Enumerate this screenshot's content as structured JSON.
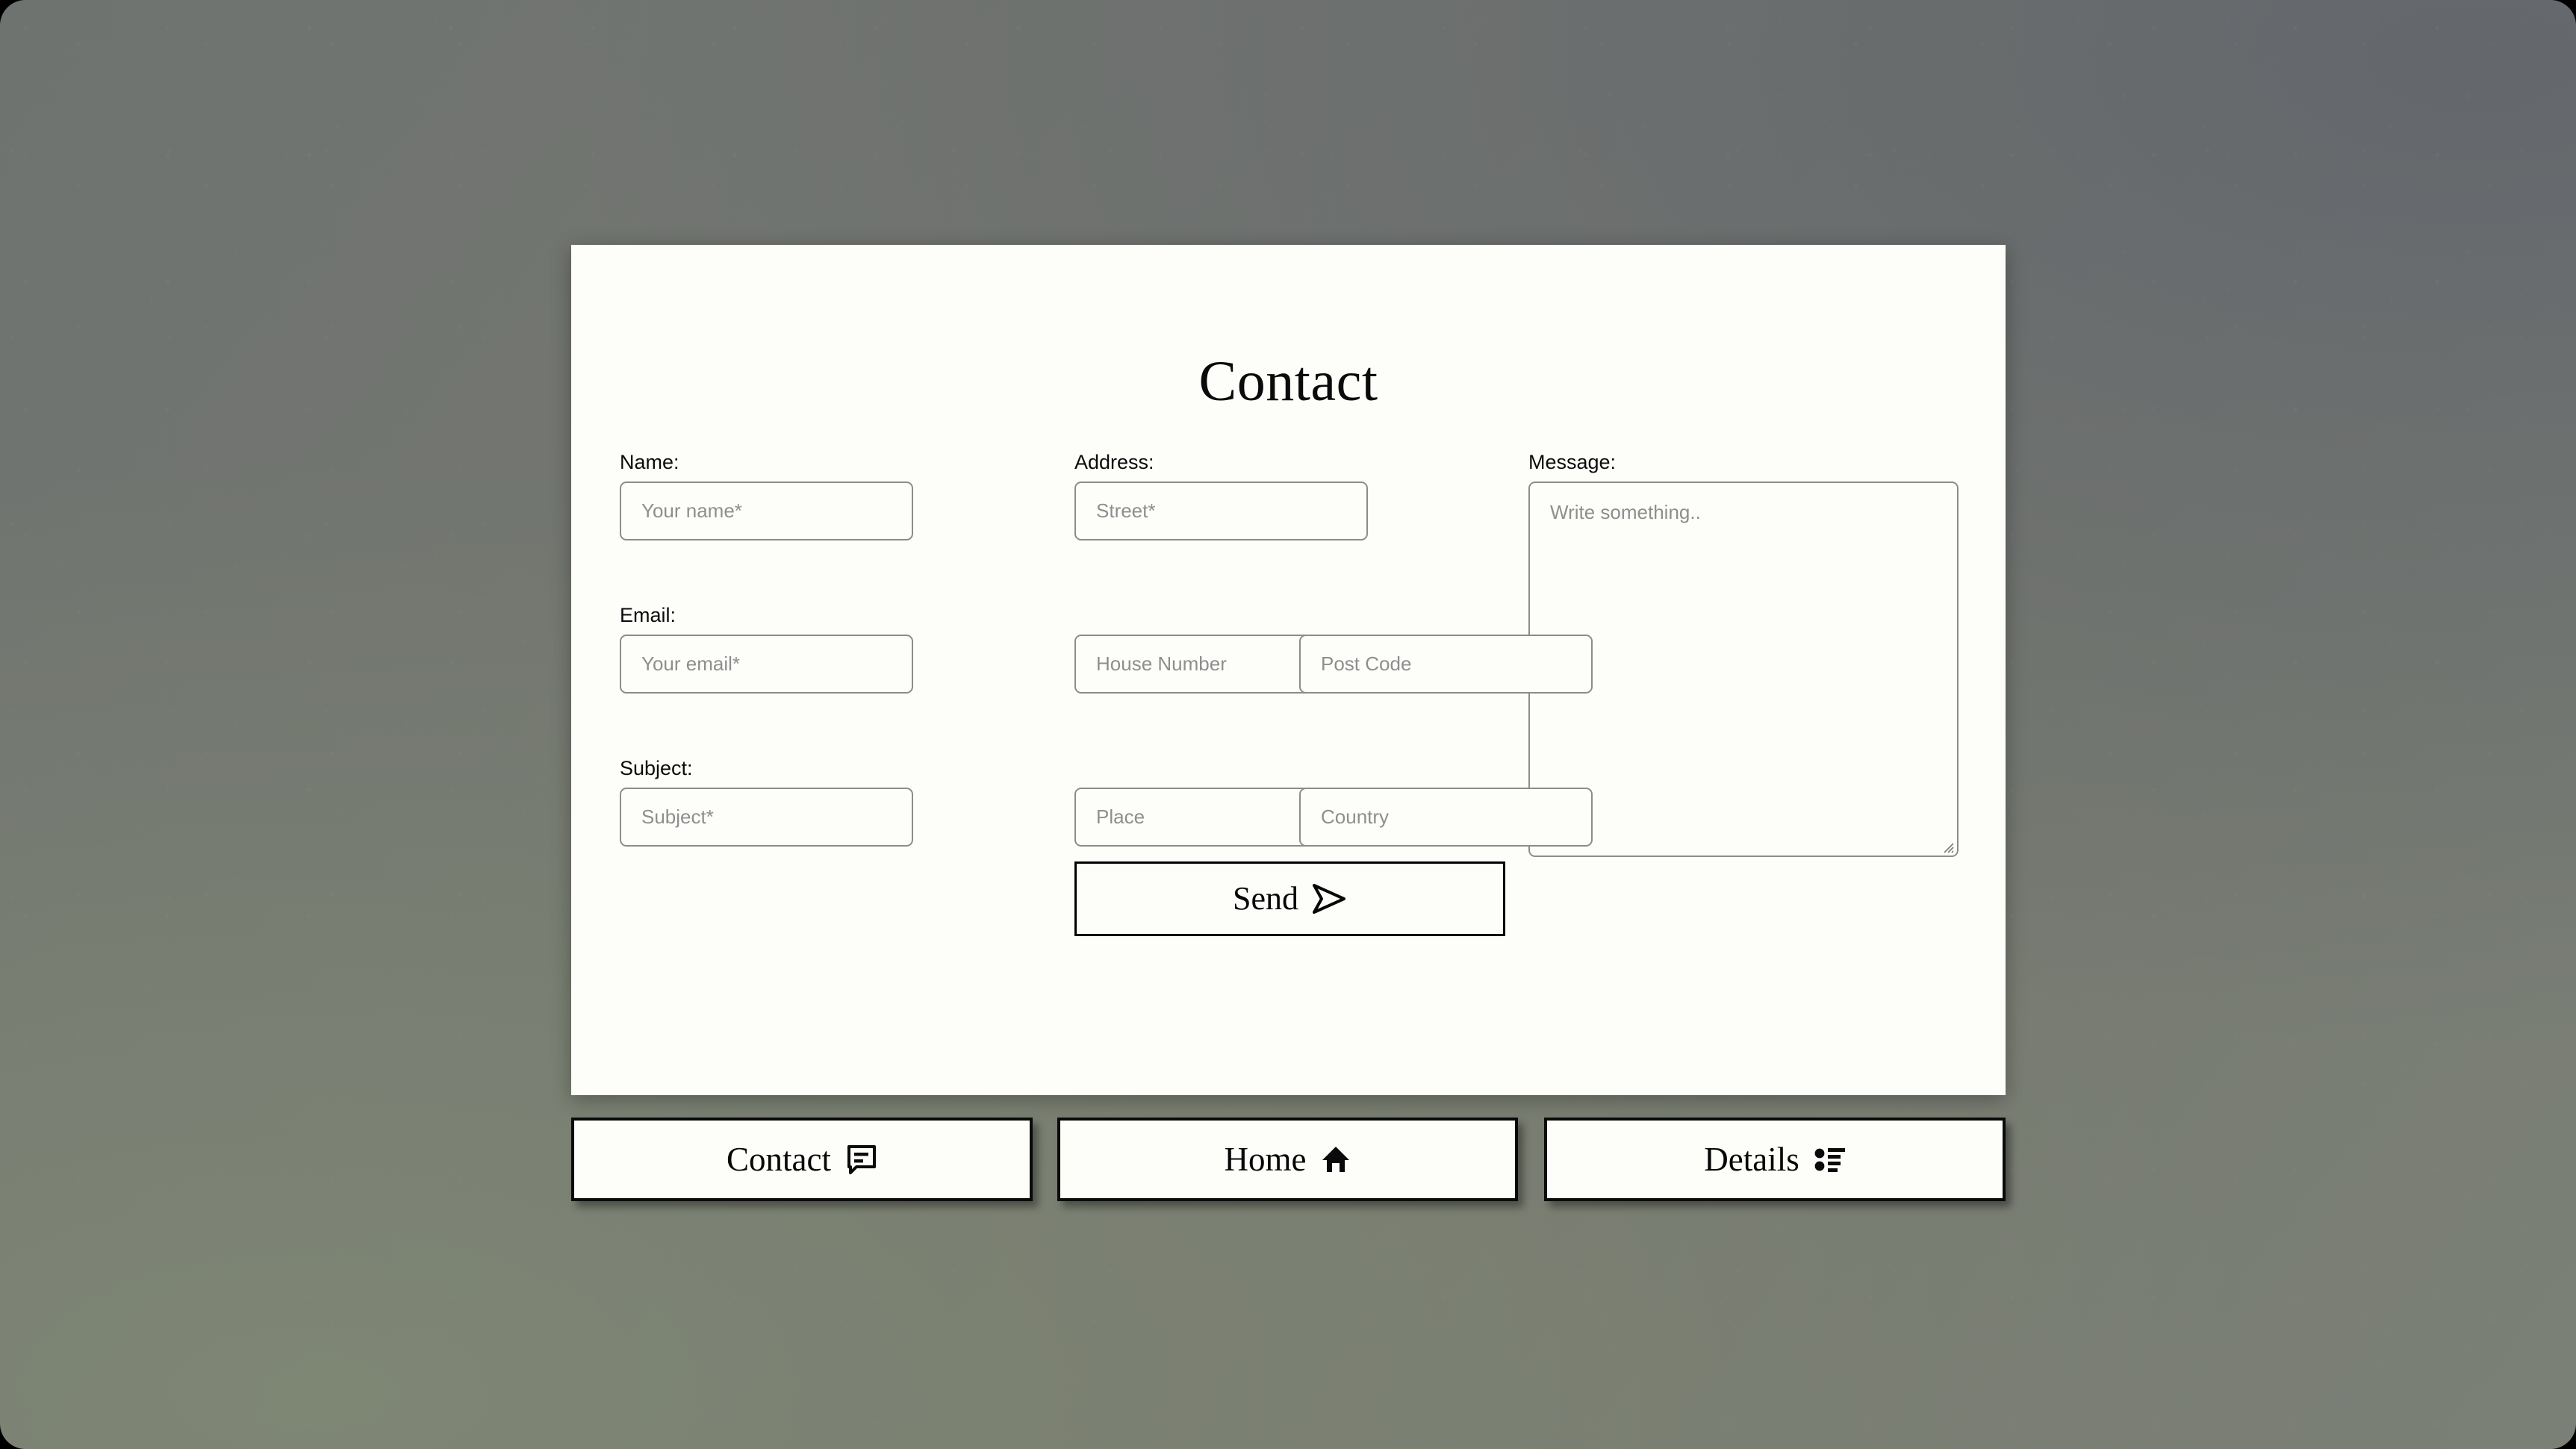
{
  "page": {
    "background_color": "#75786f",
    "card_background": "#fdfdfa",
    "accent_color": "#000000",
    "title": "Contact"
  },
  "form": {
    "fields": [
      {
        "id": "name",
        "label": "Name:",
        "placeholder": "Your name*",
        "icon": "",
        "column": "left",
        "row": 1
      },
      {
        "id": "address",
        "label": "Address:",
        "placeholder": "Street*",
        "icon": "",
        "column": "mid",
        "row": 1
      },
      {
        "id": "message",
        "label": "Message:",
        "placeholder": "Write something..",
        "icon": "resize-grip-icon",
        "column": "right",
        "row": 1
      },
      {
        "id": "email",
        "label": "Email:",
        "placeholder": "Your email*",
        "icon": "",
        "column": "left",
        "row": 2
      },
      {
        "id": "house_number",
        "label": "",
        "placeholder": "House Number",
        "icon": "",
        "column": "small-a",
        "row": 2
      },
      {
        "id": "post_code",
        "label": "",
        "placeholder": "Post Code",
        "icon": "",
        "column": "small-b",
        "row": 2
      },
      {
        "id": "subject",
        "label": "Subject:",
        "placeholder": "Subject*",
        "icon": "",
        "column": "left",
        "row": 3
      },
      {
        "id": "place",
        "label": "",
        "placeholder": "Place",
        "icon": "",
        "column": "small-a",
        "row": 3
      },
      {
        "id": "country",
        "label": "",
        "placeholder": "Country",
        "icon": "",
        "column": "small-b",
        "row": 3
      }
    ],
    "labels": {
      "name": "Name:",
      "address": "Address:",
      "message": "Message:",
      "email": "Email:",
      "subject": "Subject:"
    },
    "placeholders": {
      "name": "Your name*",
      "street": "Street*",
      "message": "Write something..",
      "email": "Your email*",
      "house_number": "House Number",
      "post_code": "Post Code",
      "subject": "Subject*",
      "place": "Place",
      "country": "Country"
    },
    "values": {
      "name": "",
      "street": "",
      "message": "",
      "email": "",
      "house_number": "",
      "post_code": "",
      "subject": "",
      "place": "",
      "country": ""
    },
    "submit": {
      "label": "Send",
      "icon": "send-arrow-icon"
    }
  },
  "bottom_nav": {
    "items": [
      {
        "id": "contact",
        "label": "Contact",
        "icon": "comment-bubble-icon"
      },
      {
        "id": "home",
        "label": "Home",
        "icon": "house-icon"
      },
      {
        "id": "details",
        "label": "Details",
        "icon": "bulleted-list-icon"
      }
    ]
  }
}
